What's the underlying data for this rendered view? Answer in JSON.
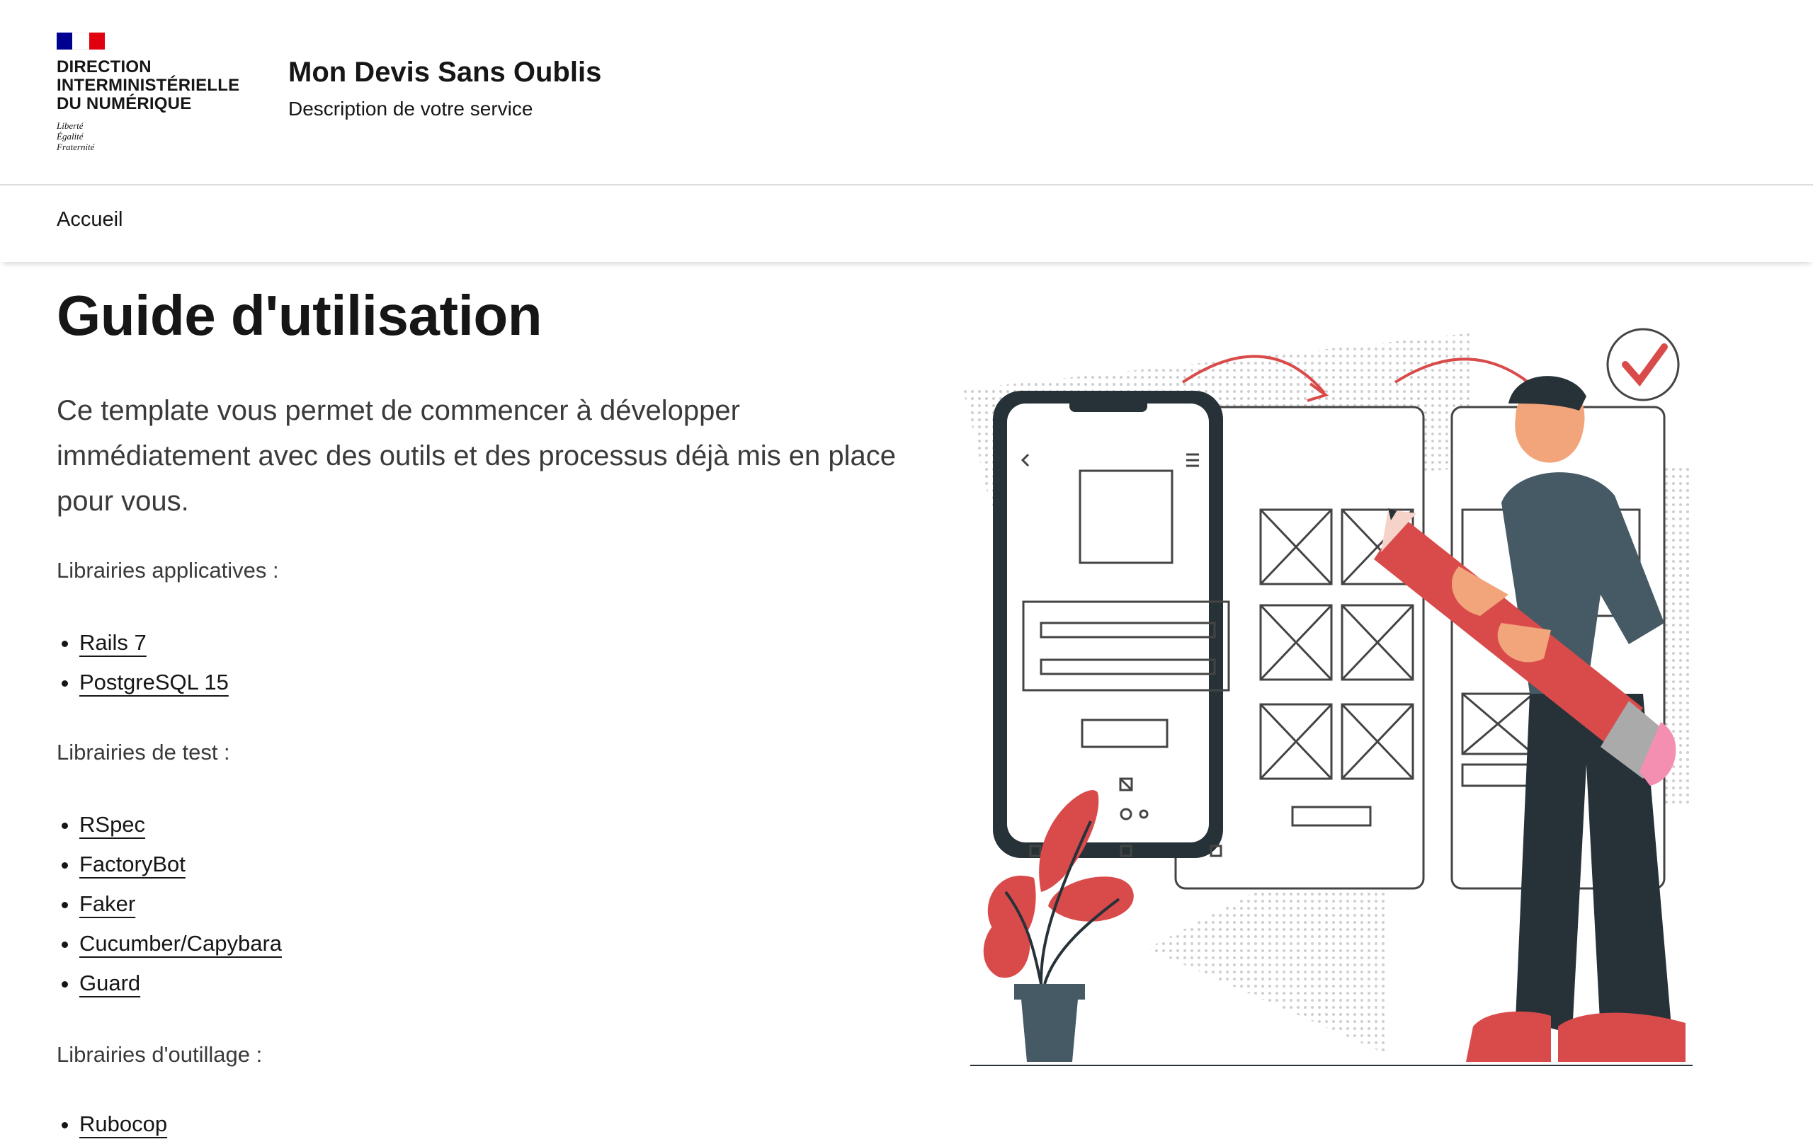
{
  "header": {
    "operator_lines": [
      "DIRECTION",
      "INTERMINISTÉRIELLE",
      "DU NUMÉRIQUE"
    ],
    "motto_lines": [
      "Liberté",
      "Égalité",
      "Fraternité"
    ],
    "service_title": "Mon Devis Sans Oublis",
    "service_description": "Description de votre service"
  },
  "nav": {
    "items": [
      {
        "label": "Accueil"
      }
    ]
  },
  "main": {
    "title": "Guide d'utilisation",
    "lead": "Ce template vous permet de commencer à développer immédiatement avec des outils et des processus déjà mis en place pour vous.",
    "sections": [
      {
        "label": "Librairies applicatives :",
        "items": [
          "Rails 7",
          "PostgreSQL 15"
        ]
      },
      {
        "label": "Librairies de test :",
        "items": [
          "RSpec",
          "FactoryBot",
          "Faker",
          "Cucumber/Capybara",
          "Guard"
        ]
      },
      {
        "label": "Librairies d'outillage :",
        "items": [
          "Rubocop"
        ]
      }
    ]
  },
  "colors": {
    "accent_red": "#d94b4b",
    "dark": "#263238",
    "flag_blue": "#000091",
    "flag_red": "#e1000f"
  }
}
